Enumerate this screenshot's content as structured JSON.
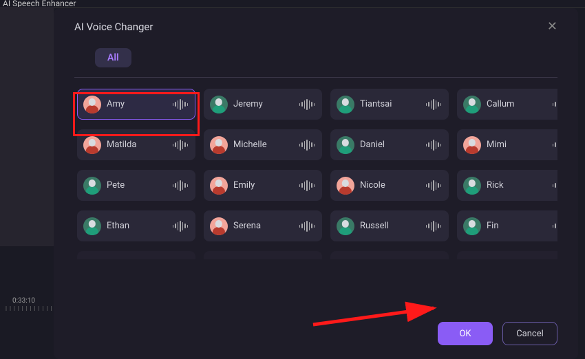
{
  "background": {
    "prev_tool_label": "AI Speech Enhancer",
    "timecode": "0:33:10"
  },
  "modal": {
    "title": "AI Voice Changer",
    "tabs": {
      "all": "All"
    },
    "selected_voice_index": 0,
    "voices": [
      {
        "name": "Amy",
        "avatar_bg": "#f2a59a",
        "body_color": "#b83b2e"
      },
      {
        "name": "Jeremy",
        "avatar_bg": "#3a7a66",
        "body_color": "#1f9e7a"
      },
      {
        "name": "Tiantsai",
        "avatar_bg": "#3a7a66",
        "body_color": "#1f9e7a"
      },
      {
        "name": "Callum",
        "avatar_bg": "#3a7a66",
        "body_color": "#1f9e7a"
      },
      {
        "name": "Matilda",
        "avatar_bg": "#f2a59a",
        "body_color": "#b83b2e"
      },
      {
        "name": "Michelle",
        "avatar_bg": "#f2a59a",
        "body_color": "#b83b2e"
      },
      {
        "name": "Daniel",
        "avatar_bg": "#3a7a66",
        "body_color": "#1f9e7a"
      },
      {
        "name": "Mimi",
        "avatar_bg": "#f2a59a",
        "body_color": "#b83b2e"
      },
      {
        "name": "Pete",
        "avatar_bg": "#3a7a66",
        "body_color": "#1f9e7a"
      },
      {
        "name": "Emily",
        "avatar_bg": "#f2a59a",
        "body_color": "#b83b2e"
      },
      {
        "name": "Nicole",
        "avatar_bg": "#f2a59a",
        "body_color": "#b83b2e"
      },
      {
        "name": "Rick",
        "avatar_bg": "#3a7a66",
        "body_color": "#1f9e7a"
      },
      {
        "name": "Ethan",
        "avatar_bg": "#3a7a66",
        "body_color": "#1f9e7a"
      },
      {
        "name": "Serena",
        "avatar_bg": "#f2a59a",
        "body_color": "#b83b2e"
      },
      {
        "name": "Russell",
        "avatar_bg": "#3a7a66",
        "body_color": "#1f9e7a"
      },
      {
        "name": "Fin",
        "avatar_bg": "#3a7a66",
        "body_color": "#1f9e7a"
      }
    ],
    "footer": {
      "ok": "OK",
      "cancel": "Cancel"
    }
  },
  "annotations": {
    "highlight_voice_index": 0,
    "arrow_points_to": "ok-button"
  }
}
